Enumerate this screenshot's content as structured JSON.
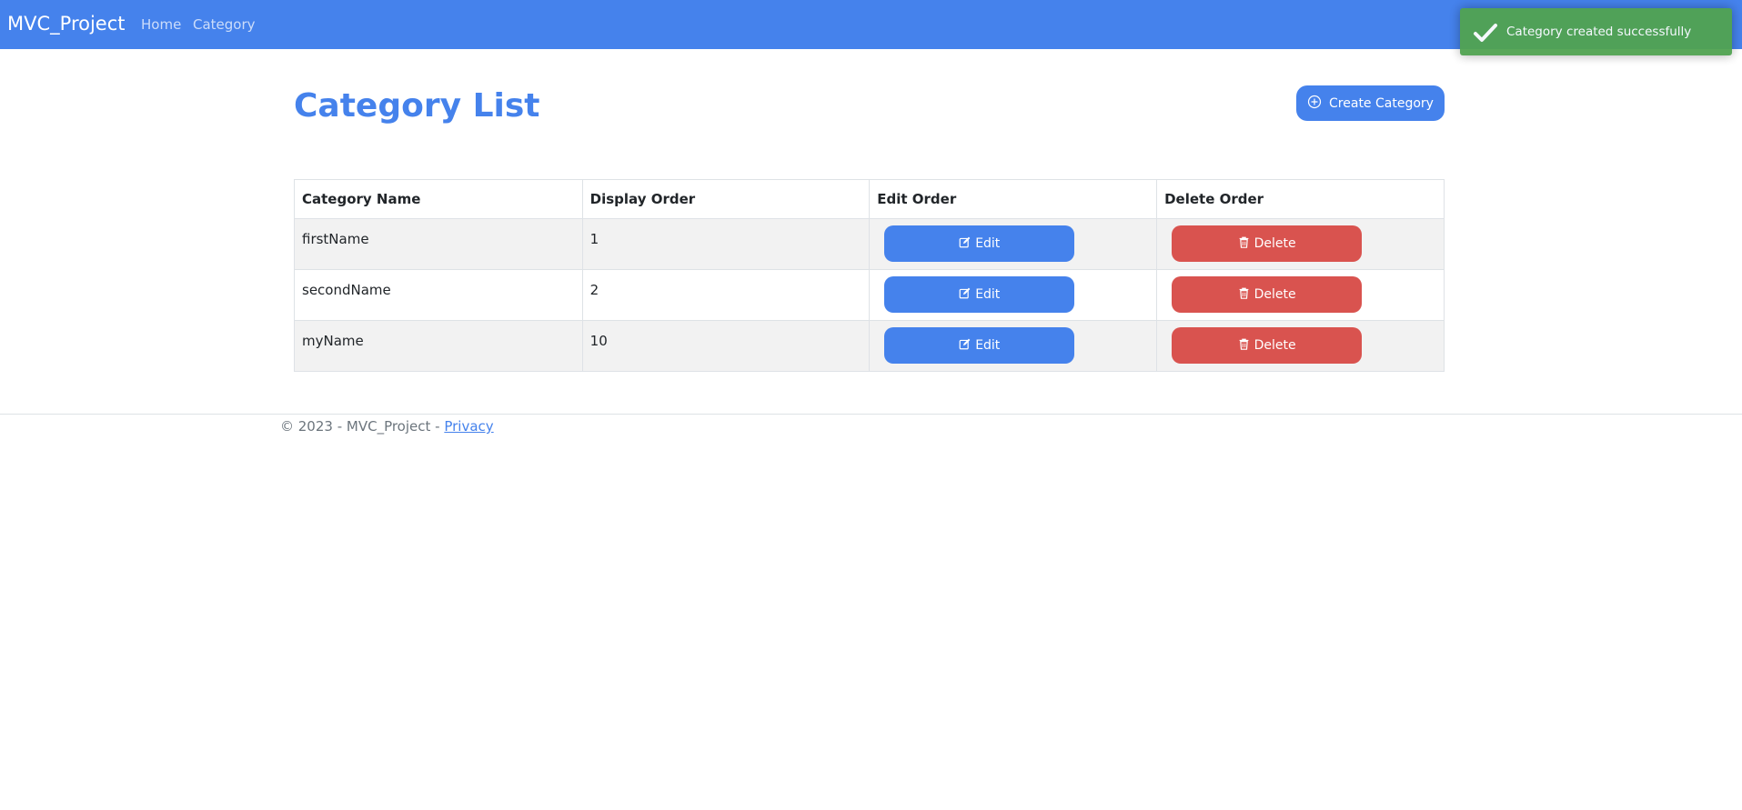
{
  "navbar": {
    "brand": "MVC_Project",
    "links": [
      "Home",
      "Category"
    ]
  },
  "toast": {
    "icon": "checkmark-icon",
    "message": "Category created successfully",
    "color": "#51a351"
  },
  "page": {
    "title": "Category List",
    "create_button": "Create Category",
    "create_icon": "plus-circle-icon"
  },
  "table": {
    "headers": [
      "Category Name",
      "Display Order",
      "Edit Order",
      "Delete Order"
    ],
    "rows": [
      {
        "name": "firstName",
        "order": "1"
      },
      {
        "name": "secondName",
        "order": "2"
      },
      {
        "name": "myName",
        "order": "10"
      }
    ],
    "edit_label": "Edit",
    "delete_label": "Delete",
    "edit_icon": "pencil-square-icon",
    "delete_icon": "trash-icon"
  },
  "footer": {
    "text": "© 2023 - MVC_Project - ",
    "privacy_link": "Privacy"
  },
  "colors": {
    "primary": "#4582ec",
    "danger": "#d9534f",
    "success": "#51a351"
  }
}
